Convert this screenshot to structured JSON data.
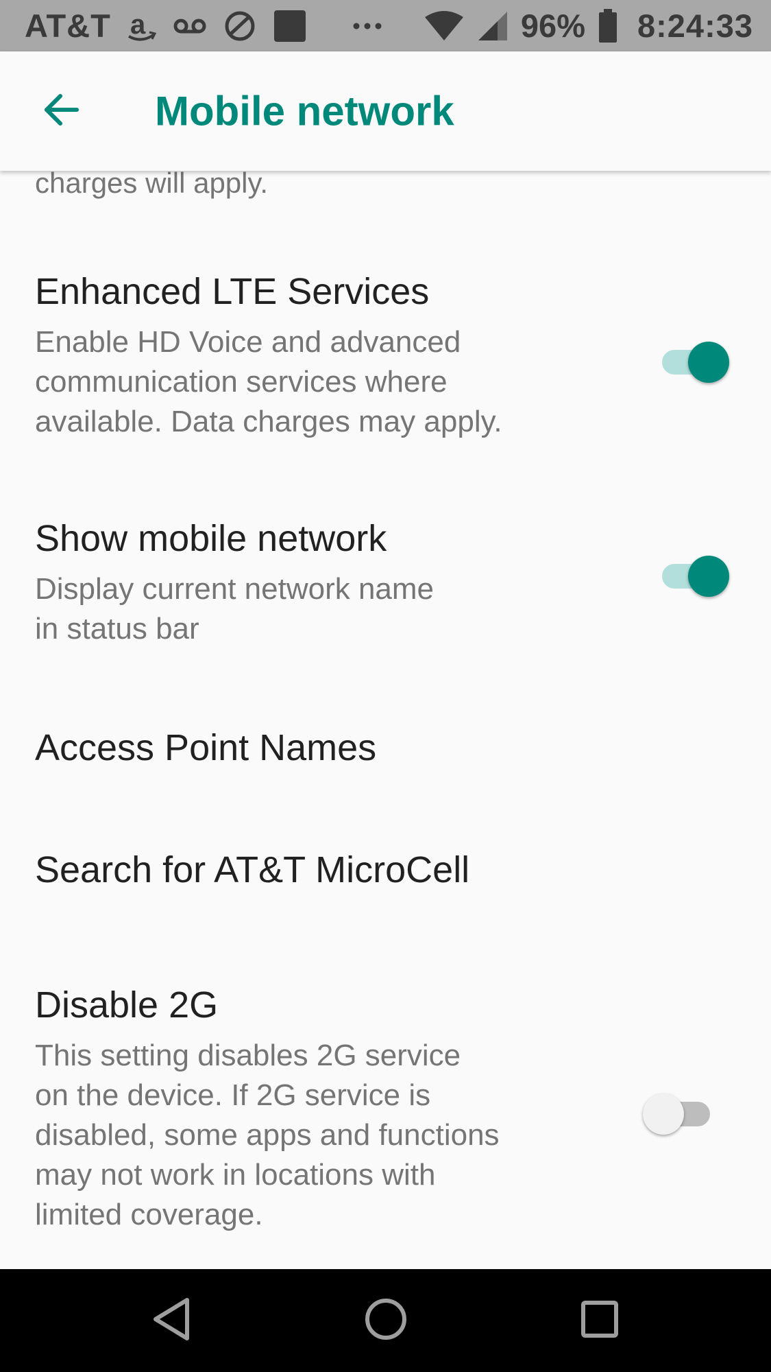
{
  "status_bar": {
    "carrier": "AT&T",
    "battery_percent": "96%",
    "time": "8:24:33",
    "icons": [
      "amazon-icon",
      "voicemail-icon",
      "abc-icon",
      "app-square-icon",
      "more-icon",
      "wifi-icon",
      "cell-signal-icon",
      "battery-icon"
    ]
  },
  "toolbar": {
    "title": "Mobile network",
    "back_icon": "arrow-back-icon"
  },
  "content": {
    "clipped_text": "charges will apply.",
    "prefs": [
      {
        "title": "Enhanced LTE Services",
        "summary": "Enable HD Voice and advanced\ncommunication services where\navailable. Data charges may apply.",
        "switch_state": "on"
      },
      {
        "title": "Show mobile network",
        "summary": "Display current network name\nin status bar",
        "switch_state": "on"
      },
      {
        "title": "Access Point Names"
      },
      {
        "title": "Search for AT&T MicroCell"
      },
      {
        "title": "Disable 2G",
        "summary": "This setting disables 2G service\non the device. If 2G service is\ndisabled, some apps and functions\nmay not work in locations with\nlimited coverage.",
        "switch_state": "off"
      }
    ]
  },
  "colors": {
    "accent": "#00897b",
    "accent_light": "#b2dfdb",
    "status_bar_bg": "#a8a8a8",
    "background": "#fafafa",
    "nav_bar_bg": "#000000"
  },
  "nav_bar": {
    "buttons": [
      "back-triangle-icon",
      "home-circle-icon",
      "recents-square-icon"
    ]
  }
}
